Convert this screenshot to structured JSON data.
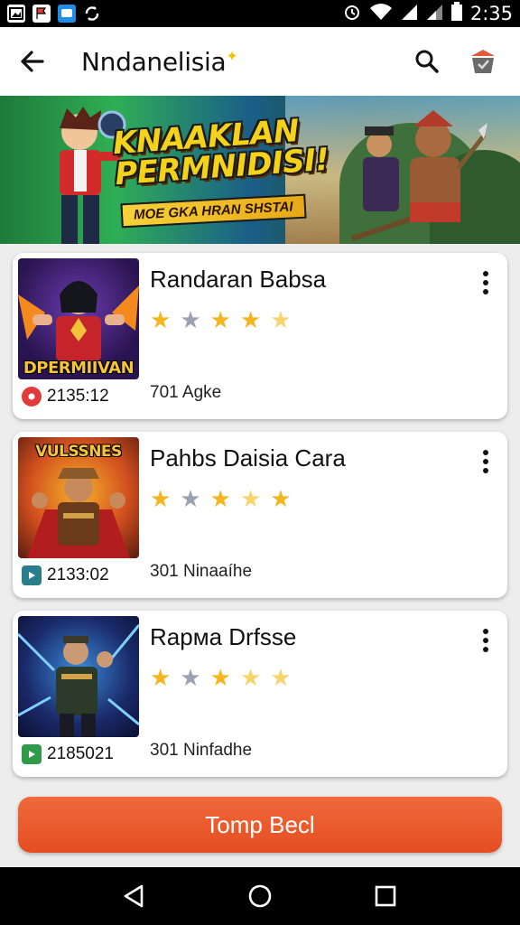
{
  "status_bar": {
    "time": "2:35",
    "notification_icons": [
      "gallery-icon",
      "flag-icon",
      "chat-icon",
      "sync-icon"
    ]
  },
  "app_bar": {
    "title": "Nndanelisia",
    "icons": [
      "back-arrow-icon",
      "search-icon",
      "basket-icon"
    ]
  },
  "banner": {
    "headline_line1": "KNAAKLAN",
    "headline_line2": "PERMNIDISI!",
    "subtitle": "MOE GKA HRAN SHSTAI"
  },
  "cards": [
    {
      "title": "Randaran Babsa",
      "thumb_label": "DPERMIIVAN",
      "code": "2135:12",
      "meta": "701 Agke",
      "badge_color": "#e03a3a",
      "badge_icon": "record-icon"
    },
    {
      "title": "Pahbs Daisia Cara",
      "thumb_label": "VULSSNES",
      "code": "2133:02",
      "meta": "301 Ninaaíhe",
      "badge_color": "#2a7d8a",
      "badge_icon": "play-icon"
    },
    {
      "title": "Raрма Drfsse",
      "thumb_label": "",
      "code": "2185021",
      "meta": "301 Ninfadhe",
      "badge_color": "#2f9a47",
      "badge_icon": "play-icon"
    }
  ],
  "primary_button": {
    "label": "Tomp Becl"
  },
  "nav_bar": {
    "icons": [
      "nav-back-icon",
      "nav-home-icon",
      "nav-recents-icon"
    ]
  },
  "colors": {
    "accent": "#e8542a",
    "star": "#f4b51f",
    "star_empty": "#9aa1b0"
  }
}
